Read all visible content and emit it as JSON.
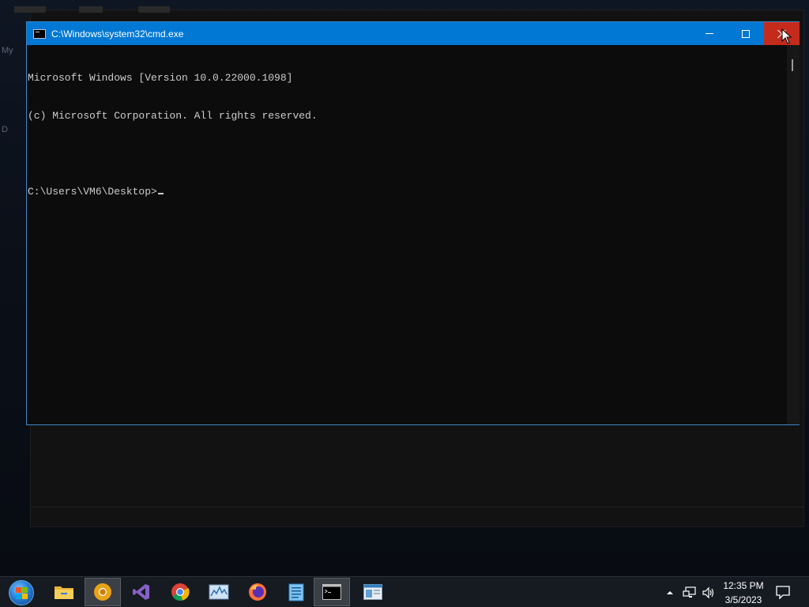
{
  "window": {
    "title": "C:\\Windows\\system32\\cmd.exe",
    "active": true
  },
  "console": {
    "lines": [
      "Microsoft Windows [Version 10.0.22000.1098]",
      "(c) Microsoft Corporation. All rights reserved.",
      "",
      "C:\\Users\\VM6\\Desktop>"
    ]
  },
  "taskbar": {
    "apps": [
      {
        "name": "File Explorer",
        "icon": "folder-icon"
      },
      {
        "name": "Chrome Canary",
        "icon": "chrome-canary-icon"
      },
      {
        "name": "Visual Studio",
        "icon": "visual-studio-icon"
      },
      {
        "name": "Google Chrome",
        "icon": "chrome-icon"
      },
      {
        "name": "Resource Monitor",
        "icon": "resource-monitor-icon"
      },
      {
        "name": "Firefox",
        "icon": "firefox-icon"
      },
      {
        "name": "Notepad",
        "icon": "notepad-icon"
      },
      {
        "name": "Command Prompt",
        "icon": "cmd-icon",
        "active": true
      },
      {
        "name": "App window",
        "icon": "app-window-icon"
      }
    ],
    "clock": {
      "time": "12:35 PM",
      "date": "3/5/2023"
    }
  },
  "colors": {
    "titlebar": "#0078d4",
    "close_hover": "#c42b1c",
    "console_bg": "#0c0c0c",
    "console_text": "#cccccc"
  }
}
